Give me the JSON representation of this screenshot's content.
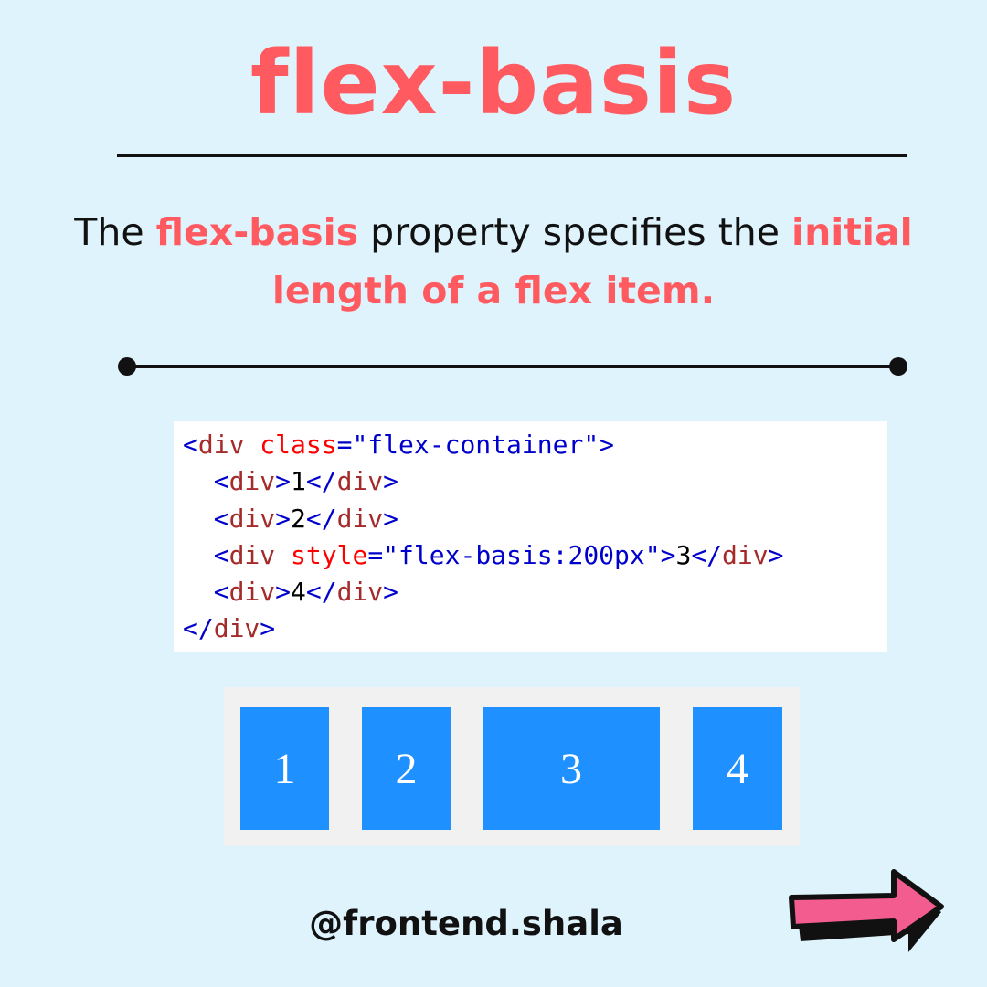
{
  "title": "flex-basis",
  "description": {
    "part1": "The ",
    "highlight1": "flex-basis",
    "part2": " property specifies the ",
    "highlight2": "initial length of a flex item."
  },
  "code_lines": [
    [
      {
        "t": "punct",
        "s": "<"
      },
      {
        "t": "tag",
        "s": "div"
      },
      {
        "t": "text",
        "s": " "
      },
      {
        "t": "attr",
        "s": "class"
      },
      {
        "t": "punct",
        "s": "=\"flex-container\">"
      }
    ],
    [
      {
        "t": "text",
        "s": "  "
      },
      {
        "t": "punct",
        "s": "<"
      },
      {
        "t": "tag",
        "s": "div"
      },
      {
        "t": "punct",
        "s": ">"
      },
      {
        "t": "text",
        "s": "1"
      },
      {
        "t": "punct",
        "s": "</"
      },
      {
        "t": "tag",
        "s": "div"
      },
      {
        "t": "punct",
        "s": ">"
      }
    ],
    [
      {
        "t": "text",
        "s": "  "
      },
      {
        "t": "punct",
        "s": "<"
      },
      {
        "t": "tag",
        "s": "div"
      },
      {
        "t": "punct",
        "s": ">"
      },
      {
        "t": "text",
        "s": "2"
      },
      {
        "t": "punct",
        "s": "</"
      },
      {
        "t": "tag",
        "s": "div"
      },
      {
        "t": "punct",
        "s": ">"
      }
    ],
    [
      {
        "t": "text",
        "s": "  "
      },
      {
        "t": "punct",
        "s": "<"
      },
      {
        "t": "tag",
        "s": "div"
      },
      {
        "t": "text",
        "s": " "
      },
      {
        "t": "attr",
        "s": "style"
      },
      {
        "t": "punct",
        "s": "=\"flex-basis:200px\">"
      },
      {
        "t": "text",
        "s": "3"
      },
      {
        "t": "punct",
        "s": "</"
      },
      {
        "t": "tag",
        "s": "div"
      },
      {
        "t": "punct",
        "s": ">"
      }
    ],
    [
      {
        "t": "text",
        "s": "  "
      },
      {
        "t": "punct",
        "s": "<"
      },
      {
        "t": "tag",
        "s": "div"
      },
      {
        "t": "punct",
        "s": ">"
      },
      {
        "t": "text",
        "s": "4"
      },
      {
        "t": "punct",
        "s": "</"
      },
      {
        "t": "tag",
        "s": "div"
      },
      {
        "t": "punct",
        "s": ">"
      }
    ],
    [
      {
        "t": "punct",
        "s": "</"
      },
      {
        "t": "tag",
        "s": "div"
      },
      {
        "t": "punct",
        "s": ">"
      }
    ]
  ],
  "demo_items": [
    "1",
    "2",
    "3",
    "4"
  ],
  "handle": "@frontend.shala",
  "colors": {
    "background": "#dff3fd",
    "accent": "#ff5a5f",
    "demo_item": "#1e90ff",
    "arrow": "#f25c8f"
  },
  "icons": {
    "next": "arrow-right-icon"
  }
}
